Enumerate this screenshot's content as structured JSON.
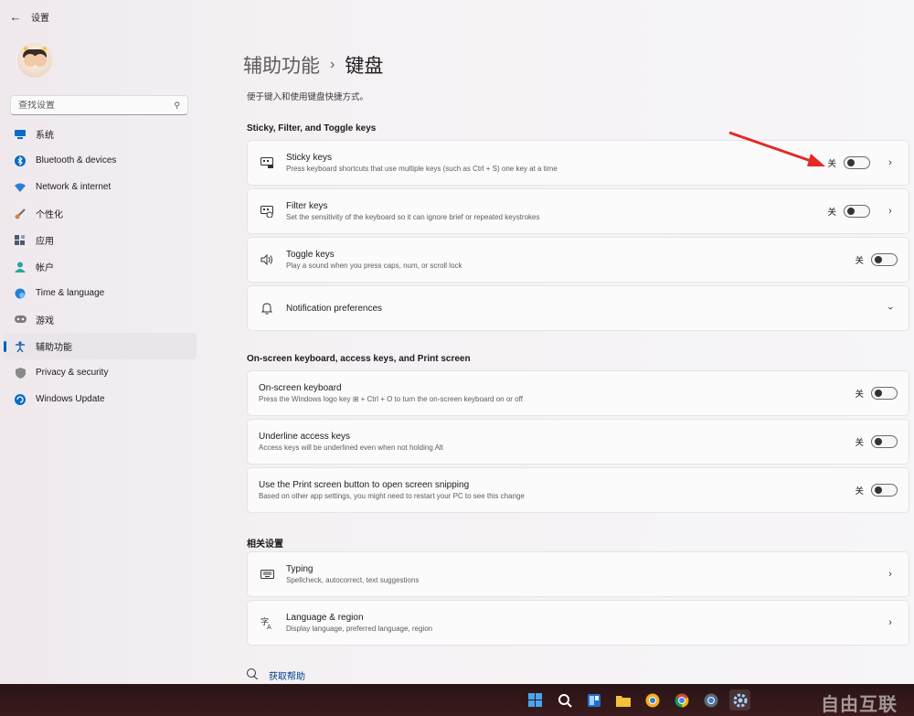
{
  "titlebar": {
    "back_icon": "arrow-left-icon",
    "title": "设置"
  },
  "sidebar": {
    "search_placeholder": "查找设置",
    "items": [
      {
        "label": "系统",
        "icon": "monitor-icon",
        "color": "#0a6cc6"
      },
      {
        "label": "Bluetooth & devices",
        "icon": "bluetooth-icon",
        "color": "#0a6cc6"
      },
      {
        "label": "Network & internet",
        "icon": "wifi-icon",
        "color": "#2b7fd4"
      },
      {
        "label": "个性化",
        "icon": "brush-icon",
        "color": "#d08a3c"
      },
      {
        "label": "应用",
        "icon": "apps-icon",
        "color": "#4a5a72"
      },
      {
        "label": "帐户",
        "icon": "person-icon",
        "color": "#26a69a"
      },
      {
        "label": "Time & language",
        "icon": "globe-clock-icon",
        "color": "#2b7fd4"
      },
      {
        "label": "游戏",
        "icon": "gamepad-icon",
        "color": "#6b6b6b"
      },
      {
        "label": "辅助功能",
        "icon": "accessibility-icon",
        "color": "#1b62b8",
        "active": true
      },
      {
        "label": "Privacy & security",
        "icon": "shield-icon",
        "color": "#8a8a8a"
      },
      {
        "label": "Windows Update",
        "icon": "update-icon",
        "color": "#0a6cc6"
      }
    ]
  },
  "main": {
    "breadcrumb_parent": "辅助功能",
    "breadcrumb_sep": "›",
    "breadcrumb_current": "键盘",
    "description": "便于键入和使用键盘快捷方式。",
    "section1": "Sticky, Filter, and Toggle keys",
    "section2": "On-screen keyboard, access keys, and Print screen",
    "section3": "相关设置",
    "cards": {
      "sticky": {
        "title": "Sticky keys",
        "sub": "Press keyboard shortcuts that use multiple keys (such as Ctrl + S) one key at a time",
        "state": "关",
        "toggle_on": false
      },
      "filter": {
        "title": "Filter keys",
        "sub": "Set the sensitivity of the keyboard so it can ignore brief or repeated keystrokes",
        "state": "关",
        "toggle_on": false
      },
      "toggle": {
        "title": "Toggle keys",
        "sub": "Play a sound when you press caps, num, or scroll lock",
        "state": "关",
        "toggle_on": false
      },
      "notif": {
        "title": "Notification preferences"
      },
      "osk": {
        "title": "On-screen keyboard",
        "sub": "Press the Windows logo key ⊞ + Ctrl + O to turn the on-screen keyboard on or off",
        "state": "关",
        "toggle_on": false
      },
      "underline": {
        "title": "Underline access keys",
        "sub": "Access keys will be underlined even when not holding Alt",
        "state": "关",
        "toggle_on": false
      },
      "prtsc": {
        "title": "Use the Print screen button to open screen snipping",
        "sub": "Based on other app settings, you might need to restart your PC to see this change",
        "state": "关",
        "toggle_on": false
      },
      "typing": {
        "title": "Typing",
        "sub": "Spellcheck, autocorrect, text suggestions"
      },
      "lang": {
        "title": "Language & region",
        "sub": "Display language, preferred language, region"
      }
    },
    "help": "获取帮助"
  },
  "taskbar": {
    "icons": [
      "windows-start-icon",
      "search-icon",
      "widgets-icon",
      "file-explorer-icon",
      "chrome-canary-icon",
      "chrome-icon",
      "chrome-dev-icon",
      "settings-icon"
    ],
    "watermark": "自由互联"
  },
  "colors": {
    "accent": "#005fb8",
    "arrow": "#e02b27",
    "taskbar": "#2a1416"
  }
}
